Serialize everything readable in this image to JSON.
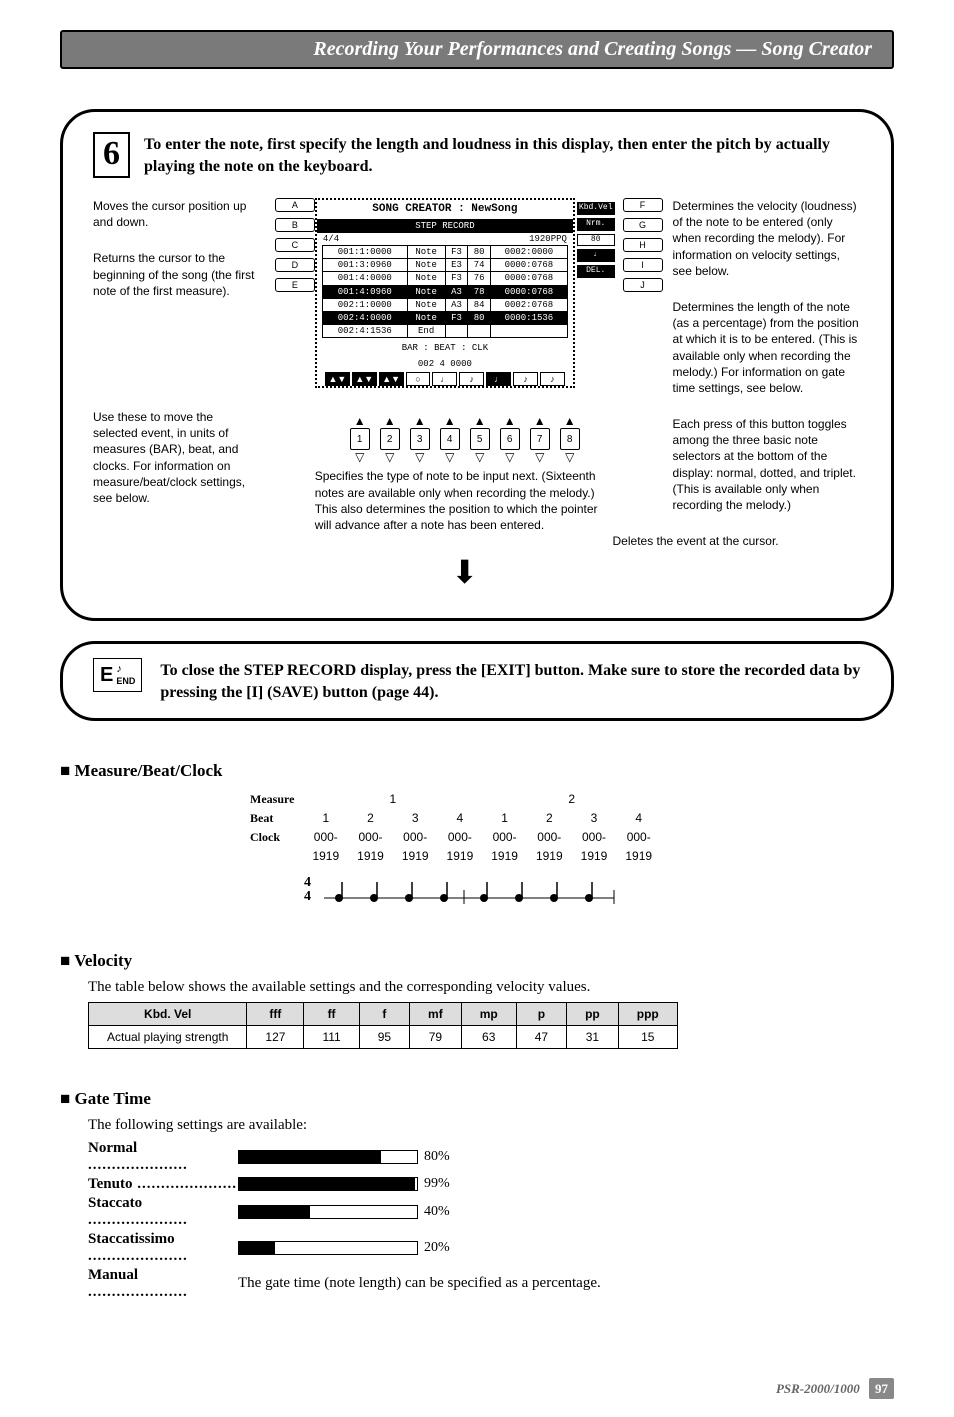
{
  "header": {
    "title": "Recording Your Performances and Creating Songs — Song Creator"
  },
  "step6": {
    "number": "6",
    "text": "To enter the note, first specify the length and loudness in this display, then enter the pitch by actually playing the note on the keyboard."
  },
  "callouts": {
    "left1": "Moves the cursor position up and down.",
    "left2": "Returns the cursor to the beginning of the song (the first note of the first measure).",
    "left3": "Use these to move the selected event, in units of measures (BAR), beat, and clocks. For information on measure/beat/clock settings, see below.",
    "mid": "Specifies the type of note to be input next. (Sixteenth notes are available only when recording the melody.) This also determines the position to which the pointer will advance after a note has been entered.",
    "right1": "Determines the velocity (loudness) of the note to be entered (only when recording the melody). For information on velocity settings, see below.",
    "right2": "Determines the length of the note (as a percentage) from the position at which it is to be entered. (This is available only when recording the melody.) For information on gate time settings, see below.",
    "right3": "Each press of this button toggles among the three basic note selectors at the bottom of the display: normal, dotted, and triplet. (This is available only when recording the melody.)",
    "right4": "Deletes the event at the cursor."
  },
  "screen": {
    "title": "SONG CREATOR : NewSong",
    "tab": "STEP RECORD",
    "meta1": "4/4",
    "meta2": "1920PPQ",
    "left_labels": [
      "A",
      "B",
      "C",
      "D",
      "E"
    ],
    "right_labels": [
      "F",
      "G",
      "H",
      "I",
      "J"
    ],
    "rows": [
      [
        "001:1:0000",
        "Note",
        "F3",
        "80",
        "0002:0000"
      ],
      [
        "001:3:0960",
        "Note",
        "E3",
        "74",
        "0000:0768"
      ],
      [
        "001:4:0000",
        "Note",
        "F3",
        "76",
        "0000:0768"
      ],
      [
        "001:4:0960",
        "Note",
        "A3",
        "78",
        "0000:0768"
      ],
      [
        "002:1:0000",
        "Note",
        "A3",
        "84",
        "0002:0768"
      ],
      [
        "002:4:0000",
        "Note",
        "F3",
        "80",
        "0000:1536"
      ],
      [
        "002:4:1536",
        "End",
        "",
        "",
        ""
      ]
    ],
    "bbc_label": "BAR : BEAT : CLK",
    "bbc_values": "002    4    0000",
    "bottom_btns": [
      "▲▼",
      "▲▼",
      "▲▼",
      "○",
      "♩",
      "♪",
      "♩",
      "♪",
      "♪"
    ],
    "side_right": [
      "Kbd.Vel",
      "Nrm.",
      "80",
      "♩",
      "DEL."
    ]
  },
  "end": {
    "label": "END",
    "text": "To close the STEP RECORD display, press the [EXIT] button. Make sure to store the recorded data by pressing the [I] (SAVE) button (page 44)."
  },
  "mbc": {
    "heading": "Measure/Beat/Clock",
    "labels": {
      "measure": "Measure",
      "beat": "Beat",
      "clock": "Clock"
    },
    "measures": [
      "1",
      "2"
    ],
    "beats": [
      "1",
      "2",
      "3",
      "4",
      "1",
      "2",
      "3",
      "4"
    ],
    "clocks_top": [
      "000-",
      "000-",
      "000-",
      "000-",
      "000-",
      "000-",
      "000-",
      "000-"
    ],
    "clocks_bot": [
      "1919",
      "1919",
      "1919",
      "1919",
      "1919",
      "1919",
      "1919",
      "1919"
    ],
    "timesig": "4/4"
  },
  "velocity": {
    "heading": "Velocity",
    "caption": "The table below shows the available settings and the corresponding velocity values.",
    "header_left": "Kbd. Vel",
    "row_left": "Actual playing strength",
    "cols": [
      "fff",
      "ff",
      "f",
      "mf",
      "mp",
      "p",
      "pp",
      "ppp"
    ],
    "vals": [
      "127",
      "111",
      "95",
      "79",
      "63",
      "47",
      "31",
      "15"
    ]
  },
  "gate": {
    "heading": "Gate Time",
    "caption": "The following settings are available:",
    "items": [
      {
        "name": "Normal",
        "pct": 80,
        "label": "80%"
      },
      {
        "name": "Tenuto",
        "pct": 99,
        "label": "99%"
      },
      {
        "name": "Staccato",
        "pct": 40,
        "label": "40%"
      },
      {
        "name": "Staccatissimo",
        "pct": 20,
        "label": "20%"
      }
    ],
    "manual_name": "Manual",
    "manual_text": "The gate time (note length) can be specified as a percentage."
  },
  "footer": {
    "model": "PSR-2000/1000",
    "page": "97"
  }
}
